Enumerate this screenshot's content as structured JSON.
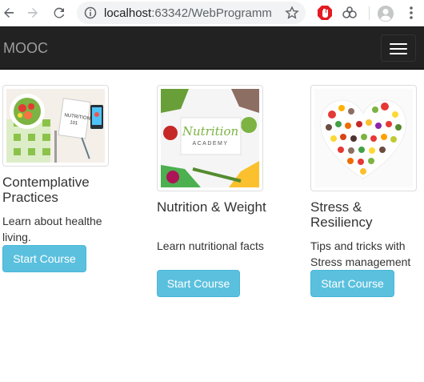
{
  "browser": {
    "url_host": "localhost",
    "url_rest": ":63342/WebProgrammi..."
  },
  "navbar": {
    "brand": "MOOC"
  },
  "courses": [
    {
      "title": "Contemplative Practices",
      "description": "Learn about healthe living.",
      "button_label": "Start Course",
      "image_text": "NUTRITION 101"
    },
    {
      "title": "Nutrition & Weight",
      "description": "Learn nutritional facts",
      "button_label": "Start Course",
      "image_text": "Nutrition",
      "image_text_2": "ACADEMY"
    },
    {
      "title": "Stress & Resiliency",
      "description": "Tips and tricks with Stress management",
      "button_label": "Start Course"
    }
  ],
  "colors": {
    "navbar": "#222222",
    "brand": "#9d9d9d",
    "button": "#5bc0de"
  }
}
